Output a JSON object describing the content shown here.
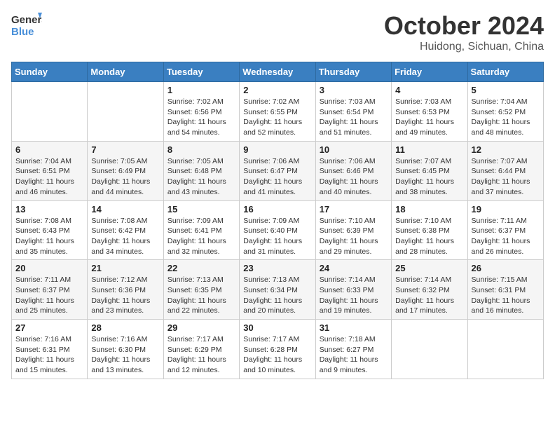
{
  "header": {
    "logo_general": "General",
    "logo_blue": "Blue",
    "month_title": "October 2024",
    "location": "Huidong, Sichuan, China"
  },
  "weekdays": [
    "Sunday",
    "Monday",
    "Tuesday",
    "Wednesday",
    "Thursday",
    "Friday",
    "Saturday"
  ],
  "weeks": [
    [
      null,
      null,
      {
        "day": 1,
        "sunrise": "7:02 AM",
        "sunset": "6:56 PM",
        "daylight": "11 hours and 54 minutes."
      },
      {
        "day": 2,
        "sunrise": "7:02 AM",
        "sunset": "6:55 PM",
        "daylight": "11 hours and 52 minutes."
      },
      {
        "day": 3,
        "sunrise": "7:03 AM",
        "sunset": "6:54 PM",
        "daylight": "11 hours and 51 minutes."
      },
      {
        "day": 4,
        "sunrise": "7:03 AM",
        "sunset": "6:53 PM",
        "daylight": "11 hours and 49 minutes."
      },
      {
        "day": 5,
        "sunrise": "7:04 AM",
        "sunset": "6:52 PM",
        "daylight": "11 hours and 48 minutes."
      }
    ],
    [
      {
        "day": 6,
        "sunrise": "7:04 AM",
        "sunset": "6:51 PM",
        "daylight": "11 hours and 46 minutes."
      },
      {
        "day": 7,
        "sunrise": "7:05 AM",
        "sunset": "6:49 PM",
        "daylight": "11 hours and 44 minutes."
      },
      {
        "day": 8,
        "sunrise": "7:05 AM",
        "sunset": "6:48 PM",
        "daylight": "11 hours and 43 minutes."
      },
      {
        "day": 9,
        "sunrise": "7:06 AM",
        "sunset": "6:47 PM",
        "daylight": "11 hours and 41 minutes."
      },
      {
        "day": 10,
        "sunrise": "7:06 AM",
        "sunset": "6:46 PM",
        "daylight": "11 hours and 40 minutes."
      },
      {
        "day": 11,
        "sunrise": "7:07 AM",
        "sunset": "6:45 PM",
        "daylight": "11 hours and 38 minutes."
      },
      {
        "day": 12,
        "sunrise": "7:07 AM",
        "sunset": "6:44 PM",
        "daylight": "11 hours and 37 minutes."
      }
    ],
    [
      {
        "day": 13,
        "sunrise": "7:08 AM",
        "sunset": "6:43 PM",
        "daylight": "11 hours and 35 minutes."
      },
      {
        "day": 14,
        "sunrise": "7:08 AM",
        "sunset": "6:42 PM",
        "daylight": "11 hours and 34 minutes."
      },
      {
        "day": 15,
        "sunrise": "7:09 AM",
        "sunset": "6:41 PM",
        "daylight": "11 hours and 32 minutes."
      },
      {
        "day": 16,
        "sunrise": "7:09 AM",
        "sunset": "6:40 PM",
        "daylight": "11 hours and 31 minutes."
      },
      {
        "day": 17,
        "sunrise": "7:10 AM",
        "sunset": "6:39 PM",
        "daylight": "11 hours and 29 minutes."
      },
      {
        "day": 18,
        "sunrise": "7:10 AM",
        "sunset": "6:38 PM",
        "daylight": "11 hours and 28 minutes."
      },
      {
        "day": 19,
        "sunrise": "7:11 AM",
        "sunset": "6:37 PM",
        "daylight": "11 hours and 26 minutes."
      }
    ],
    [
      {
        "day": 20,
        "sunrise": "7:11 AM",
        "sunset": "6:37 PM",
        "daylight": "11 hours and 25 minutes."
      },
      {
        "day": 21,
        "sunrise": "7:12 AM",
        "sunset": "6:36 PM",
        "daylight": "11 hours and 23 minutes."
      },
      {
        "day": 22,
        "sunrise": "7:13 AM",
        "sunset": "6:35 PM",
        "daylight": "11 hours and 22 minutes."
      },
      {
        "day": 23,
        "sunrise": "7:13 AM",
        "sunset": "6:34 PM",
        "daylight": "11 hours and 20 minutes."
      },
      {
        "day": 24,
        "sunrise": "7:14 AM",
        "sunset": "6:33 PM",
        "daylight": "11 hours and 19 minutes."
      },
      {
        "day": 25,
        "sunrise": "7:14 AM",
        "sunset": "6:32 PM",
        "daylight": "11 hours and 17 minutes."
      },
      {
        "day": 26,
        "sunrise": "7:15 AM",
        "sunset": "6:31 PM",
        "daylight": "11 hours and 16 minutes."
      }
    ],
    [
      {
        "day": 27,
        "sunrise": "7:16 AM",
        "sunset": "6:31 PM",
        "daylight": "11 hours and 15 minutes."
      },
      {
        "day": 28,
        "sunrise": "7:16 AM",
        "sunset": "6:30 PM",
        "daylight": "11 hours and 13 minutes."
      },
      {
        "day": 29,
        "sunrise": "7:17 AM",
        "sunset": "6:29 PM",
        "daylight": "11 hours and 12 minutes."
      },
      {
        "day": 30,
        "sunrise": "7:17 AM",
        "sunset": "6:28 PM",
        "daylight": "11 hours and 10 minutes."
      },
      {
        "day": 31,
        "sunrise": "7:18 AM",
        "sunset": "6:27 PM",
        "daylight": "11 hours and 9 minutes."
      },
      null,
      null
    ]
  ],
  "labels": {
    "sunrise": "Sunrise:",
    "sunset": "Sunset:",
    "daylight": "Daylight:"
  }
}
